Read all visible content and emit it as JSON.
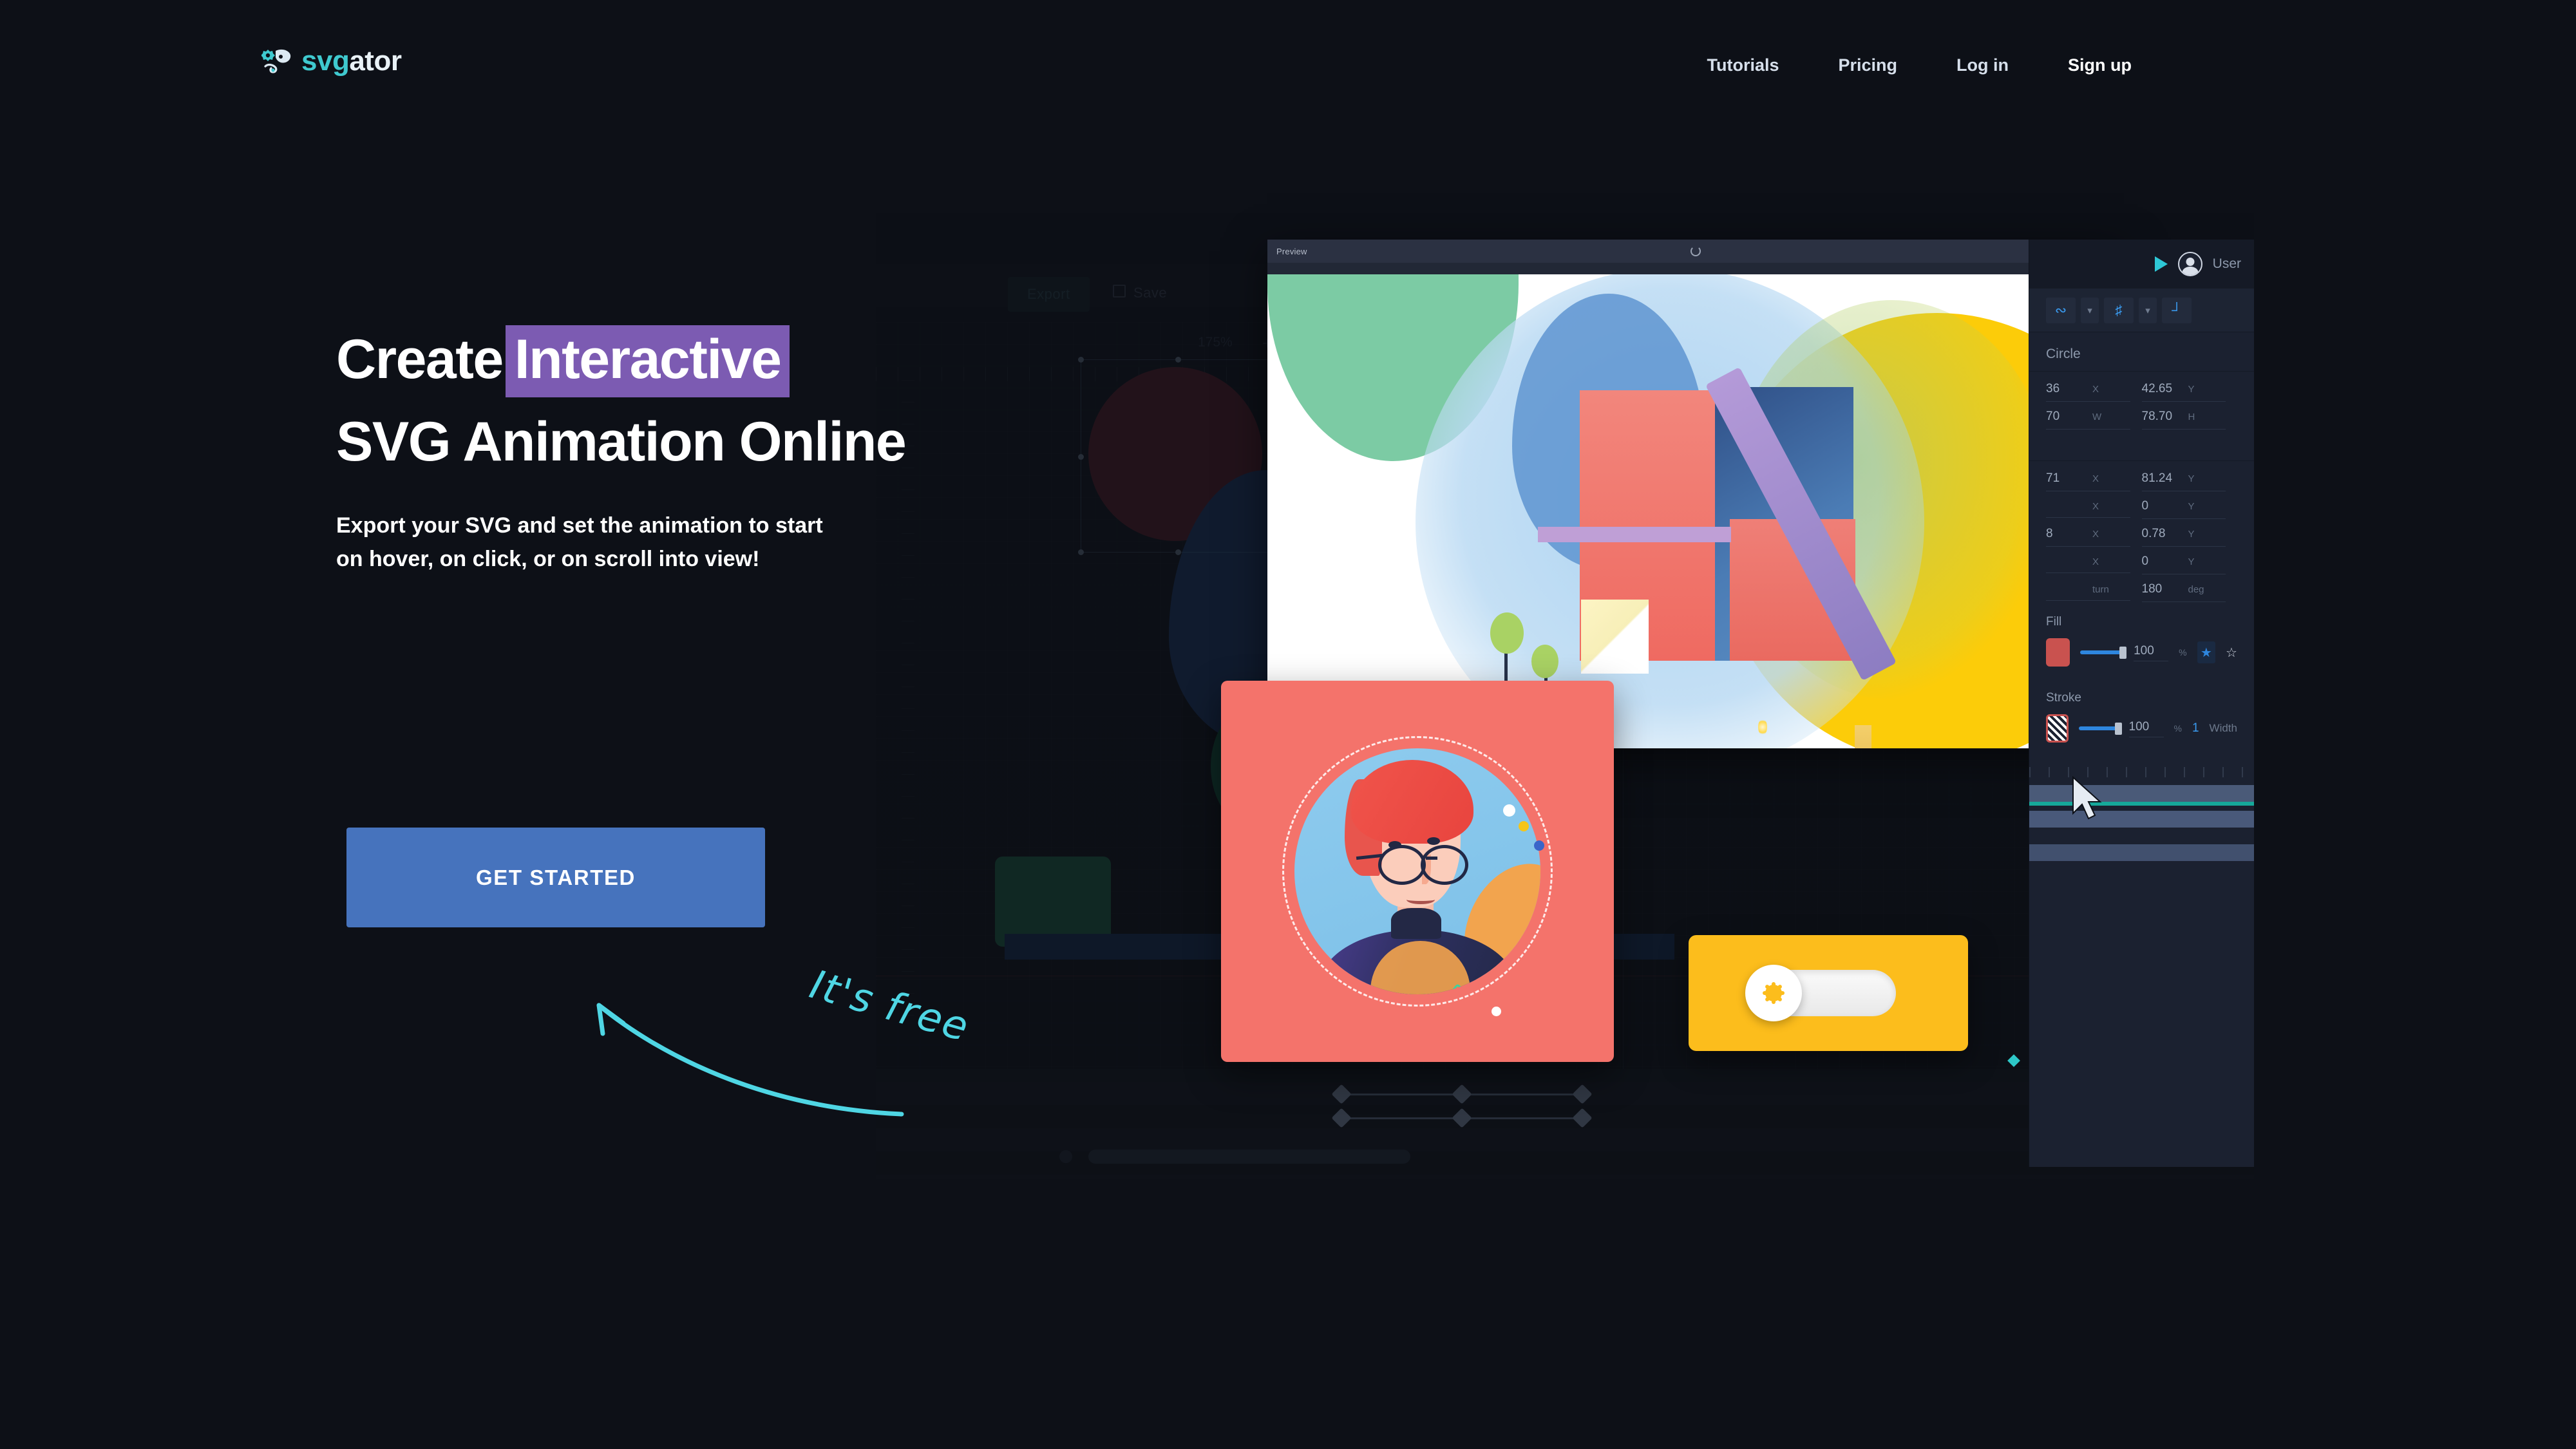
{
  "brand": {
    "logo_svg": "svg",
    "logo_ator": "ator",
    "logo_icon": "gator-gear-icon"
  },
  "nav": {
    "items": [
      {
        "label": "Tutorials",
        "name": "nav-tutorials"
      },
      {
        "label": "Pricing",
        "name": "nav-pricing"
      },
      {
        "label": "Log in",
        "name": "nav-login"
      },
      {
        "label": "Sign up",
        "name": "nav-signup"
      }
    ]
  },
  "hero": {
    "headline_part1": "Create",
    "headline_highlight": "Interactive",
    "headline_line2": "SVG Animation Online",
    "highlight_color": "#7c5bb2",
    "subtitle_line1": "Export your SVG and set the animation to start",
    "subtitle_line2": "on hover, on click, or on scroll into view!",
    "cta_label": "GET STARTED",
    "cta_color": "#4673bd",
    "annotation": "It's free",
    "annotation_color": "#4fd6e4"
  },
  "app": {
    "background_toolbar": {
      "export_label": "Export",
      "save_label": "Save",
      "zoom_level": "175%",
      "zoom_in_label": "+"
    },
    "preview_window": {
      "title": "Preview",
      "refresh_icon": "refresh-icon",
      "close_label": "×"
    },
    "right_panel": {
      "play_icon": "play-icon",
      "user_label": "User",
      "avatar_icon": "user-avatar-icon",
      "tools": [
        "magnet-icon",
        "chevron-down-icon",
        "grid-icon",
        "chevron-down-icon",
        "ruler-icon"
      ],
      "object_name": "Circle",
      "transform_rows": [
        {
          "left_value": "36",
          "left_label": "X",
          "right_value": "42.65",
          "right_label": "Y"
        },
        {
          "left_value": "70",
          "left_label": "W",
          "right_value": "78.70",
          "right_label": "H"
        }
      ],
      "motion_rows": [
        {
          "left_value": "71",
          "left_label": "X",
          "right_value": "81.24",
          "right_label": "Y"
        },
        {
          "left_value": "",
          "left_label": "X",
          "right_value": "0",
          "right_label": "Y"
        },
        {
          "left_value": "8",
          "left_label": "X",
          "right_value": "0.78",
          "right_label": "Y"
        },
        {
          "left_value": "",
          "left_label": "X",
          "right_value": "0",
          "right_label": "Y"
        },
        {
          "left_value": "",
          "left_label": "turn",
          "right_value": "180",
          "right_label": "deg"
        }
      ],
      "fill": {
        "section_label": "Fill",
        "color": "#c9524f",
        "opacity": "100",
        "opacity_symbol": "%",
        "star_filled_icon": "star-filled-icon",
        "star_outline_icon": "star-outline-icon"
      },
      "stroke": {
        "section_label": "Stroke",
        "opacity": "100",
        "opacity_symbol": "%",
        "width_value": "1",
        "width_label": "Width"
      }
    }
  },
  "cards": {
    "avatar_card": {
      "name": "avatar-illustration-card",
      "background_color": "#f4736b"
    },
    "toggle_card": {
      "name": "day-night-toggle-card",
      "background_color": "#fcbd1c",
      "icon": "sun-icon"
    }
  }
}
